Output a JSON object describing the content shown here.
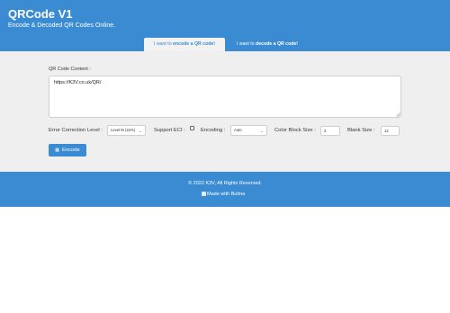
{
  "header": {
    "title": "QRCode V1",
    "subtitle": "Encode & Decoded QR Codes Online."
  },
  "tabs": [
    {
      "prefix": "I want to",
      "bold": "encode a QR code!",
      "active": true
    },
    {
      "prefix": "I want to",
      "bold": "decode a QR code!",
      "active": false
    }
  ],
  "form": {
    "content_label": "QR Code Content :",
    "content_value": "https://K3V.co.uk/QR/",
    "error_correction_label": "Error Correction Level :",
    "error_correction_value": "Level M (15%)",
    "support_eci_label": "Support ECI :",
    "encoding_label": "Encoding :",
    "encoding_value": "Auto",
    "color_block_size_label": "Color Block Size :",
    "color_block_size_value": "3",
    "blank_size_label": "Blank Size :",
    "blank_size_value": "12",
    "encode_button": "Encode"
  },
  "footer": {
    "copyright": "© 2022 K3V, All Rights Reserved.",
    "made_with": "Made with Bulma"
  },
  "colors": {
    "brand_blue": "#3a8bd2",
    "panel_gray": "#efefef"
  }
}
